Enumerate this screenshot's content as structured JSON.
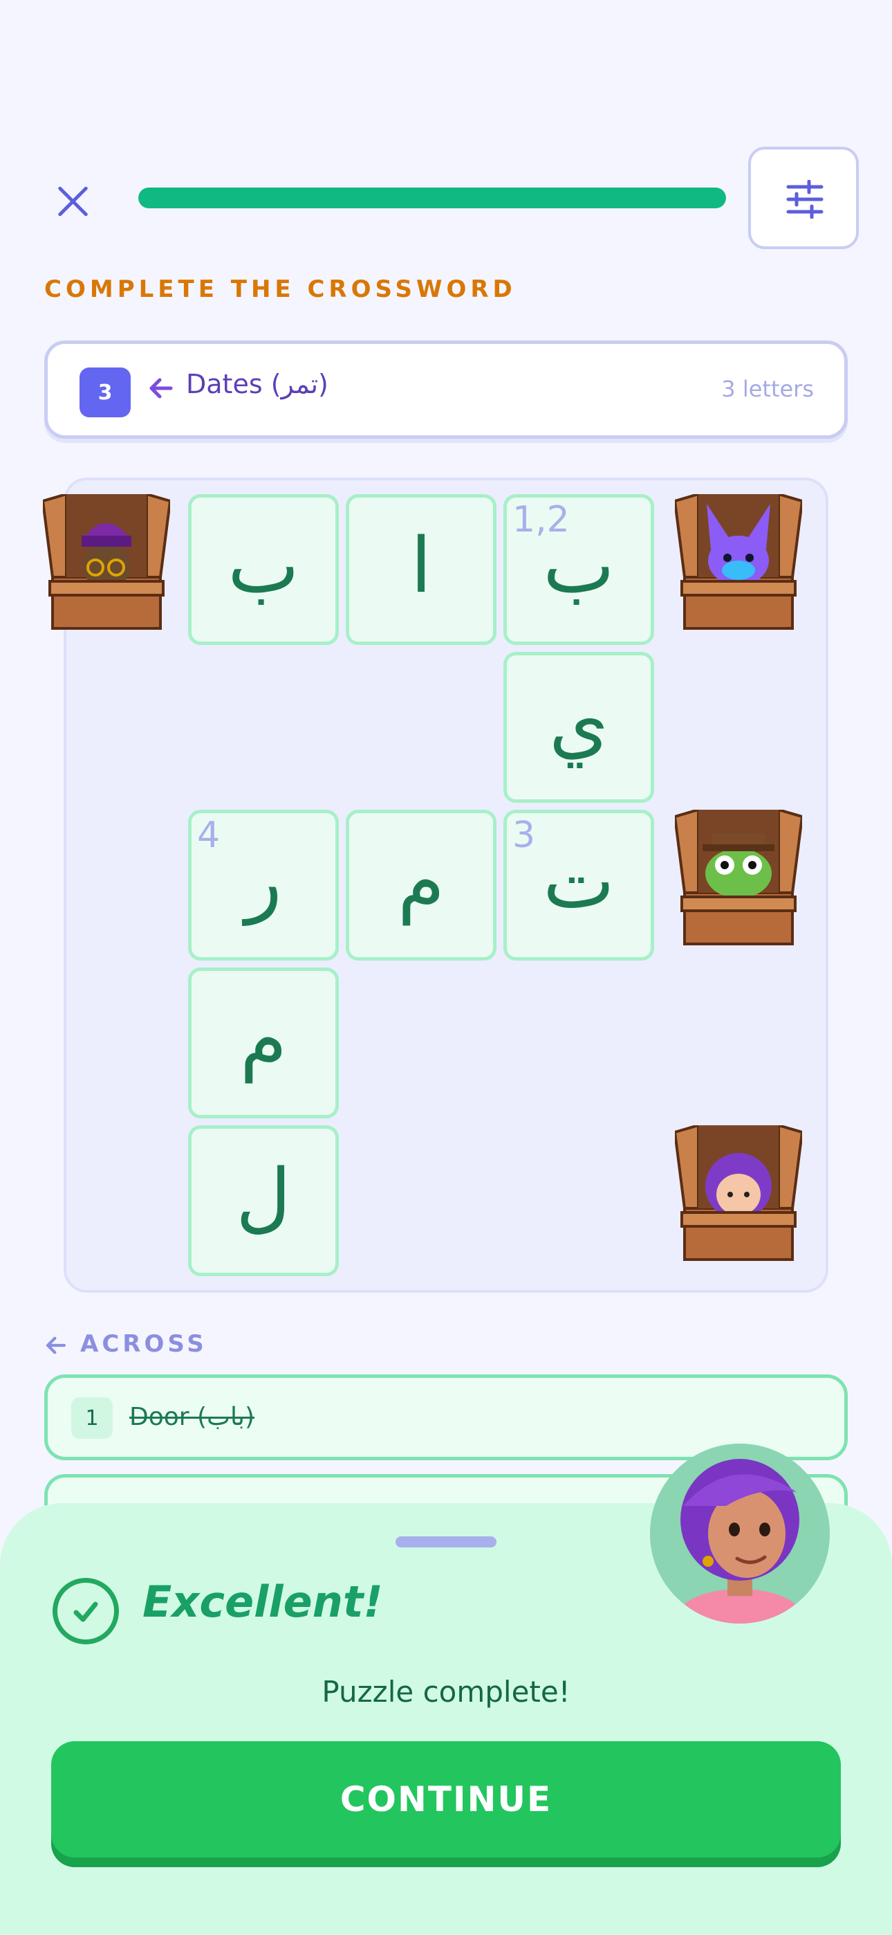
{
  "header": {
    "progress_percent": 100
  },
  "instruction": "COMPLETE THE CROSSWORD",
  "current_clue": {
    "number": "3",
    "text": "Dates (تمر)",
    "length_label": "3 letters"
  },
  "grid": {
    "cells": [
      {
        "letter": "ب",
        "number": ""
      },
      {
        "letter": "ا",
        "number": ""
      },
      {
        "letter": "ب",
        "number": "1,2"
      },
      {
        "letter": "ي",
        "number": ""
      },
      {
        "letter": "ر",
        "number": "4"
      },
      {
        "letter": "م",
        "number": ""
      },
      {
        "letter": "ت",
        "number": "3"
      },
      {
        "letter": "م",
        "number": ""
      },
      {
        "letter": "ل",
        "number": ""
      }
    ]
  },
  "across": {
    "heading": "ACROSS",
    "items": [
      {
        "number": "1",
        "text": "Door (باب)",
        "completed": true
      }
    ]
  },
  "feedback": {
    "title": "Excellent!",
    "message": "Puzzle complete!",
    "continue_label": "CONTINUE"
  },
  "colors": {
    "accent": "#6366f1",
    "success": "#22c55e",
    "progress": "#10b981",
    "instruction": "#d97706"
  }
}
